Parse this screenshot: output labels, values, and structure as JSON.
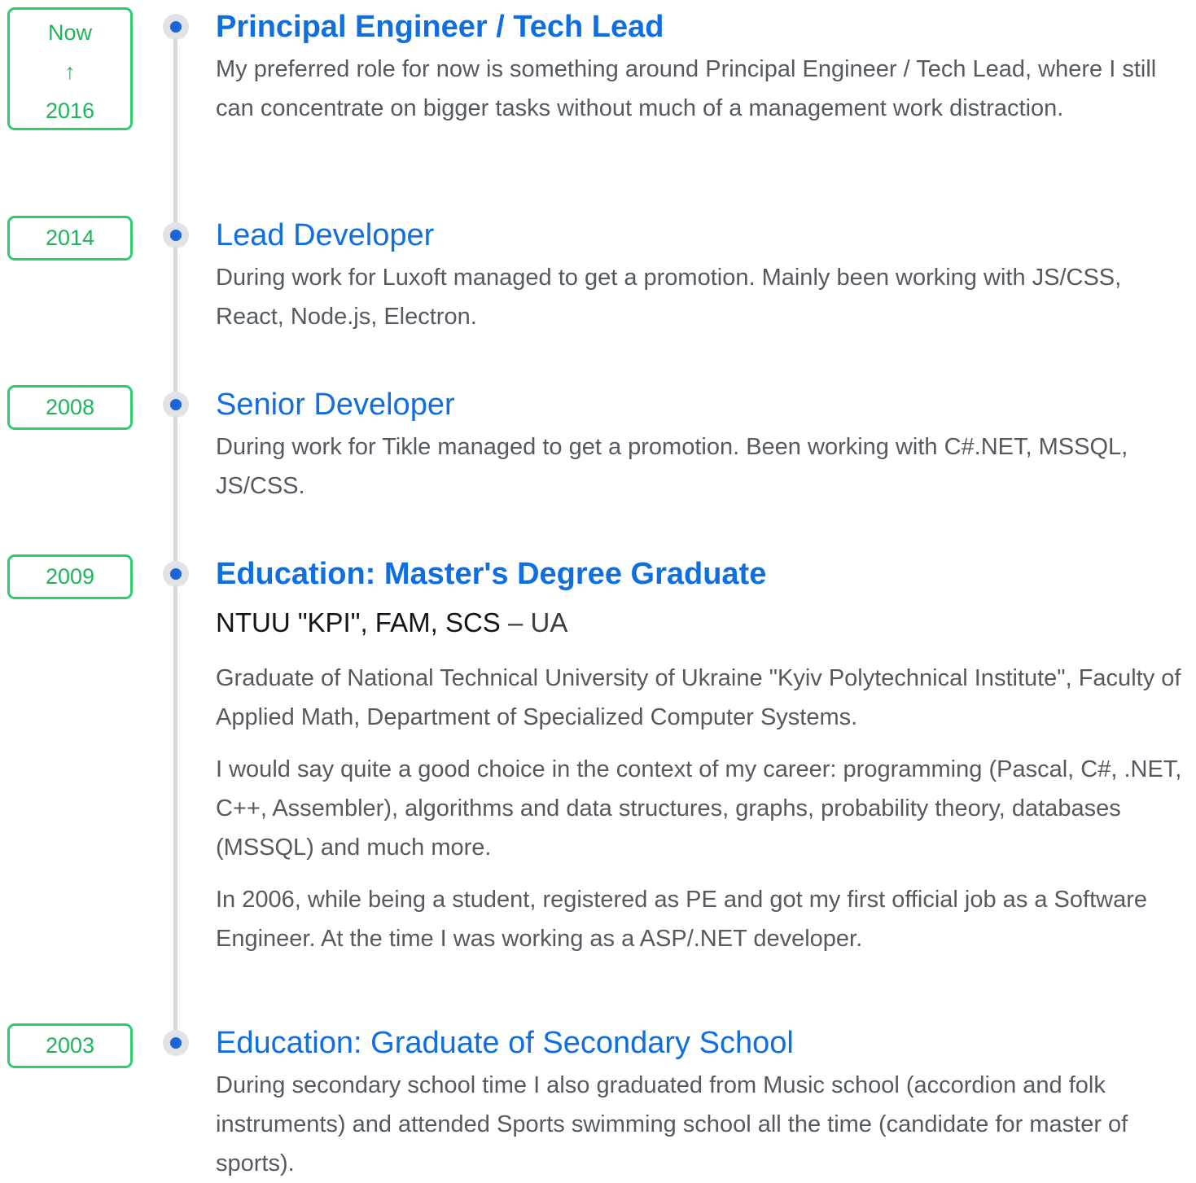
{
  "colors": {
    "accent": "#0f6fe0",
    "badge": "#2fcc6b",
    "dot": "#1a66d9",
    "line": "#d6d8dc",
    "text": "#555a60"
  },
  "entries": [
    {
      "date_from": "Now",
      "arrow": "↑",
      "date_to": "2016",
      "title": "Principal Engineer / Tech Lead",
      "description": "My preferred role for now is something around Principal Engineer / Tech Lead, where I still can concentrate on bigger tasks without much of a management work distraction."
    },
    {
      "date": "2014",
      "title": "Lead Developer",
      "description": "During work for Luxoft managed to get a promotion. Mainly been working with JS/CSS, React, Node.js, Electron."
    },
    {
      "date": "2008",
      "title": "Senior Developer",
      "description": "During work for Tikle managed to get a promotion. Been working with C#.NET, MSSQL, JS/CSS."
    },
    {
      "date": "2009",
      "title": "Education: Master's Degree Graduate",
      "institution": "NTUU \"KPI\", FAM, SCS",
      "location_sep": " – ",
      "location": "UA",
      "paragraphs": [
        "Graduate of National Technical University of Ukraine \"Kyiv Polytechnical Institute\", Faculty of Applied Math, Department of Specialized Computer Systems.",
        "I would say quite a good choice in the context of my career: programming (Pascal, C#, .NET, C++, Assembler), algorithms and data structures, graphs, probability theory, databases (MSSQL) and much more.",
        "In 2006, while being a student, registered as PE and got my first official job as a Software Engineer. At the time I was working as a ASP/.NET developer."
      ]
    },
    {
      "date": "2003",
      "title": "Education: Graduate of Secondary School",
      "description": "During secondary school time I also graduated from Music school (accordion and folk instruments) and attended Sports swimming school all the time (candidate for master of sports)."
    }
  ]
}
